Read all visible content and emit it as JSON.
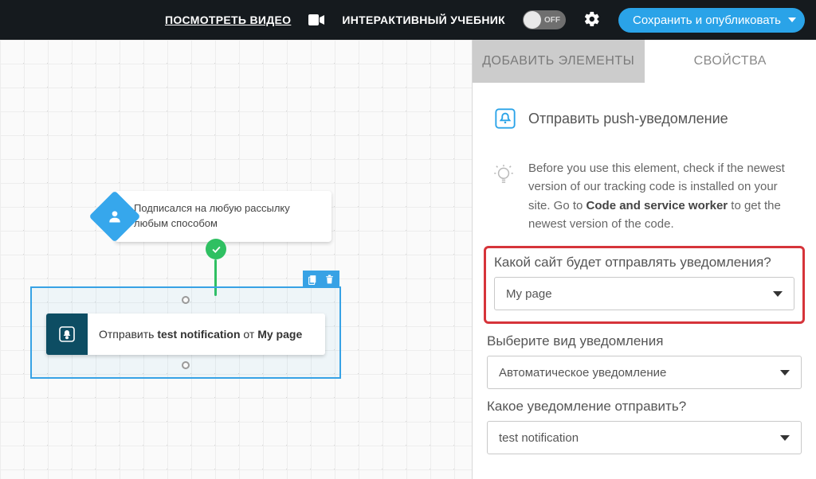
{
  "topbar": {
    "video_link": "ПОСМОТРЕТЬ ВИДЕО",
    "tutorial_label": "ИНТЕРАКТИВНЫЙ УЧЕБНИК",
    "toggle_state": "OFF",
    "publish_label": "Сохранить и опубликовать"
  },
  "canvas": {
    "node1_text": "Подписался на любую рассылку любым способом",
    "node2_prefix": "Отправить ",
    "node2_bold1": "test notification",
    "node2_mid": " от ",
    "node2_bold2": "My page"
  },
  "panel": {
    "tab_add": "ДОБАВИТЬ ЭЛЕМЕНТЫ",
    "tab_props": "СВОЙСТВА",
    "header_title": "Отправить push-уведомление",
    "info_part1": "Before you use this element, check if the newest version of our tracking code is installed on your site. Go to ",
    "info_bold": "Code and service worker",
    "info_part2": " to get the newest version of the code.",
    "field1_label": "Какой сайт будет отправлять уведомления?",
    "field1_value": "My page",
    "field2_label": "Выберите вид уведомления",
    "field2_value": "Автоматическое уведомление",
    "field3_label": "Какое уведомление отправить?",
    "field3_value": "test notification"
  }
}
